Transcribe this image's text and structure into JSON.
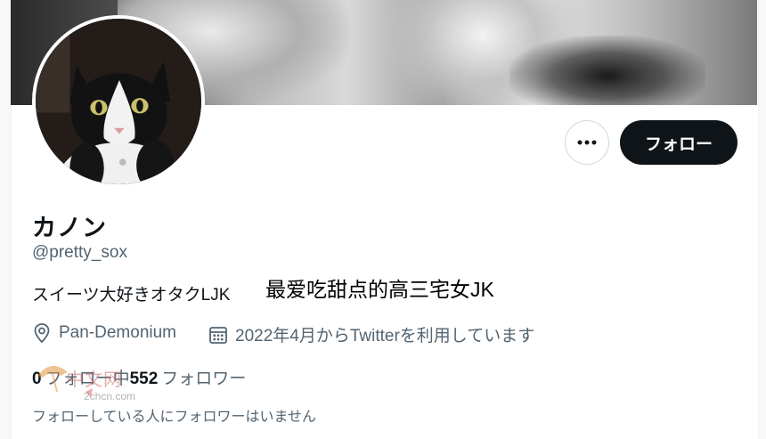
{
  "profile": {
    "display_name": "カノン",
    "handle": "@pretty_sox",
    "bio": "スイーツ大好きオタクLJK",
    "location": "Pan-Demonium",
    "joined": "2022年4月からTwitterを利用しています",
    "following_count": "0",
    "following_label": "フォロー中",
    "followers_count": "552",
    "followers_label": "フォロワー",
    "mutual_note": "フォローしている人にフォロワーはいません"
  },
  "actions": {
    "follow_label": "フォロー",
    "more_icon": "more-horizontal-icon"
  },
  "overlay": {
    "caption": "最爱吃甜点的高三宅女JK"
  },
  "watermark": {
    "text": "中文网",
    "site": "2chcn.com"
  },
  "icons": {
    "location": "location-pin-icon",
    "calendar": "calendar-icon"
  },
  "colors": {
    "text_primary": "#0f1419",
    "text_secondary": "#536471",
    "follow_button_bg": "#0f1419"
  }
}
